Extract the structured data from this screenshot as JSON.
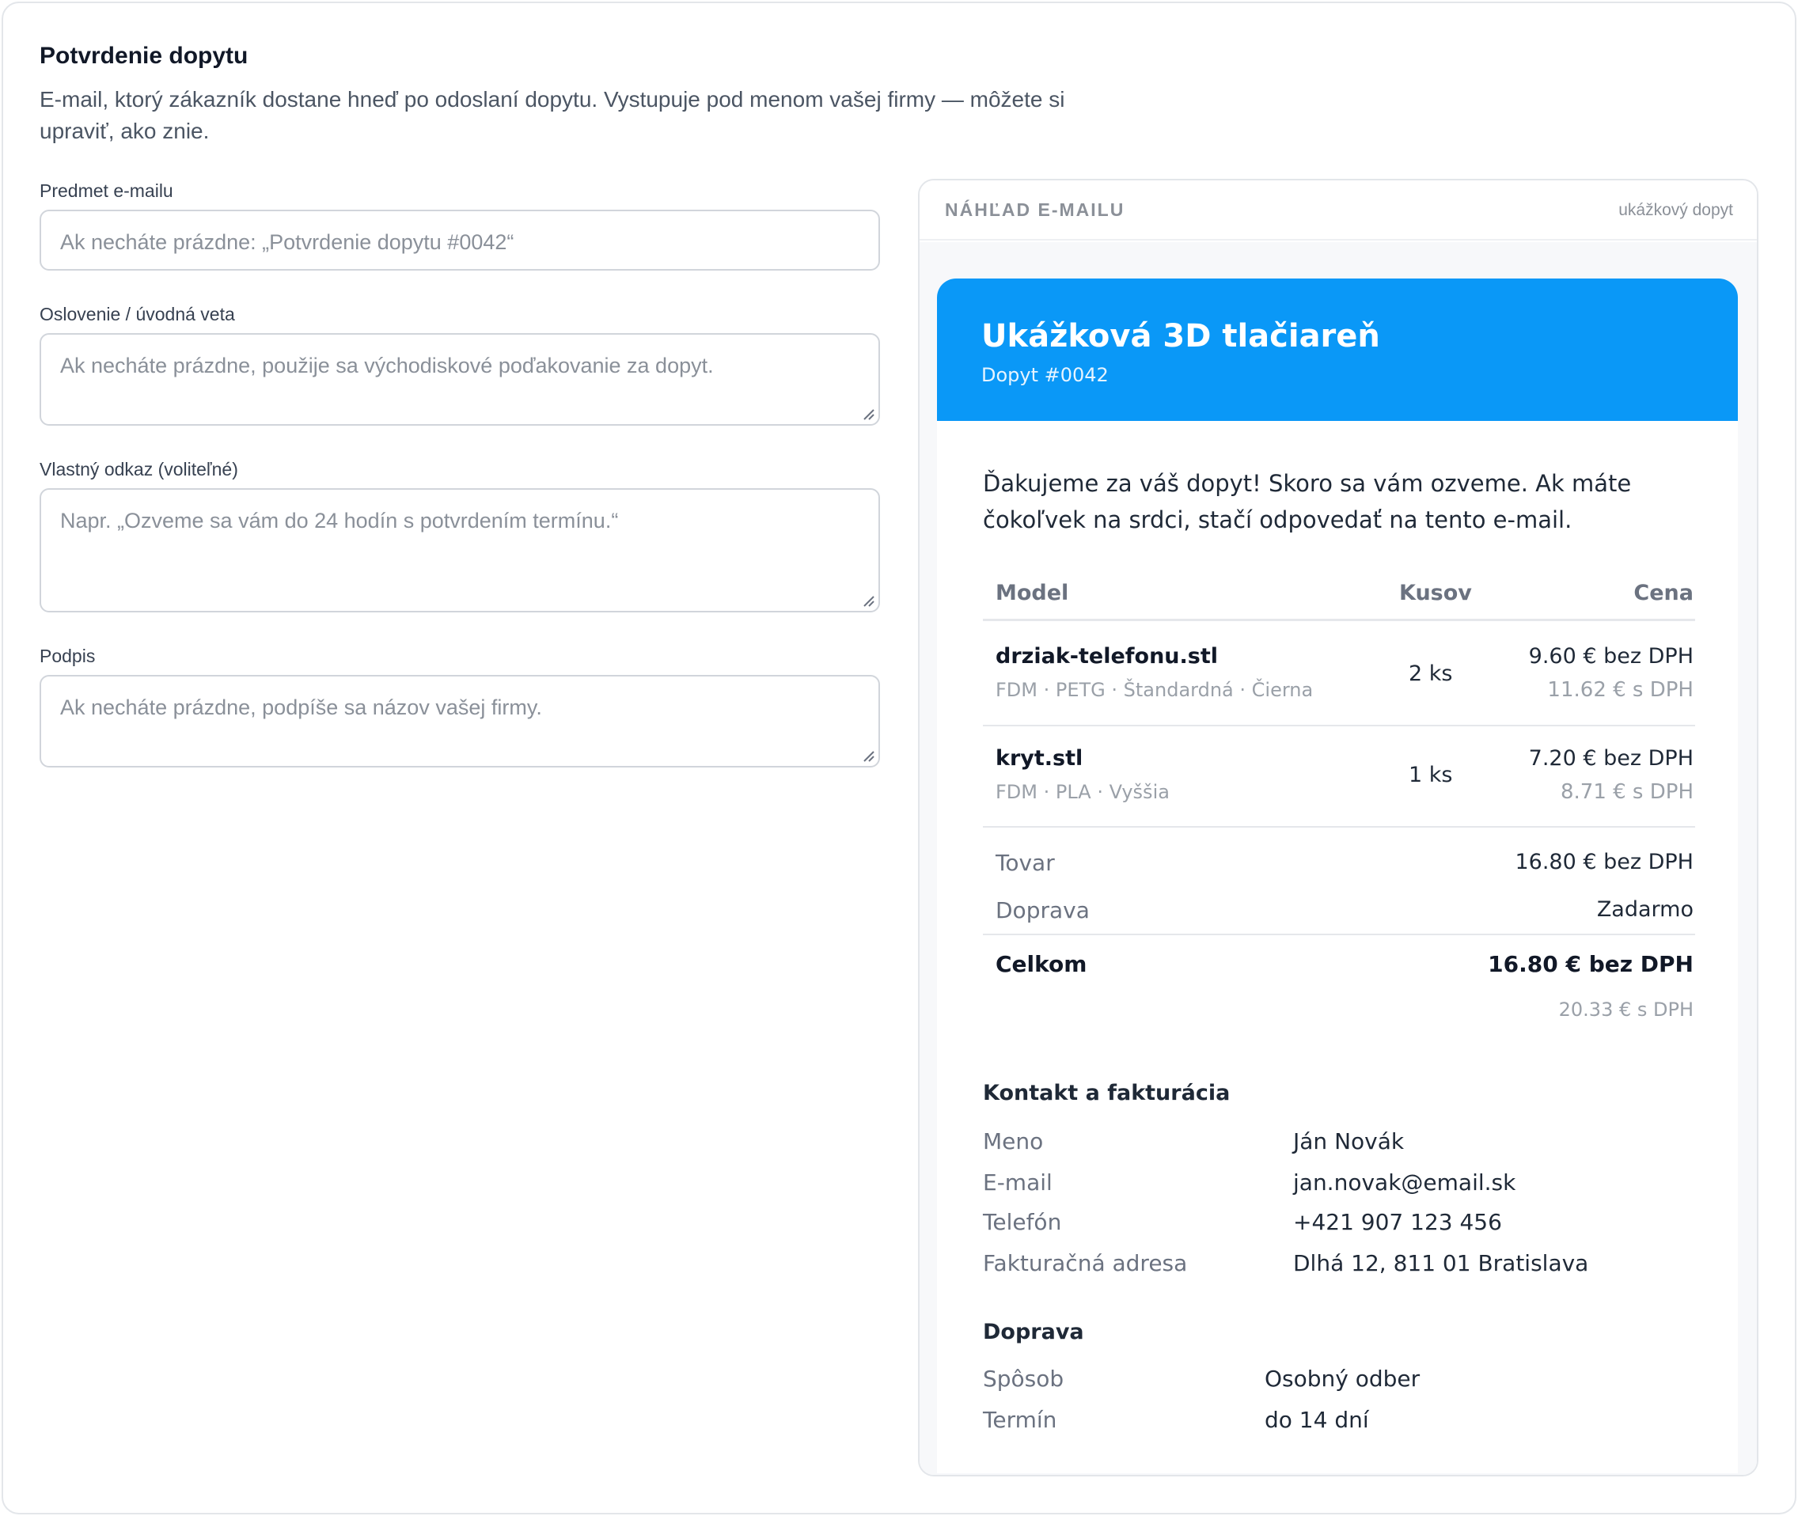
{
  "page": {
    "title": "Potvrdenie dopytu",
    "description": "E-mail, ktorý zákazník dostane hneď po odoslaní dopytu. Vystupuje pod menom vašej firmy — môžete si upraviť, ako znie."
  },
  "form": {
    "subject": {
      "label": "Predmet e-mailu",
      "placeholder": "Ak necháte prázdne: „Potvrdenie dopytu #0042“",
      "value": ""
    },
    "greeting": {
      "label": "Oslovenie / úvodná veta",
      "placeholder": "Ak necháte prázdne, použije sa východiskové poďakovanie za dopyt.",
      "value": ""
    },
    "custom_message": {
      "label": "Vlastný odkaz (voliteľné)",
      "placeholder": "Napr. „Ozveme sa vám do 24 hodín s potvrdením termínu.“",
      "value": ""
    },
    "signature": {
      "label": "Podpis",
      "placeholder": "Ak necháte prázdne, podpíše sa názov vašej firmy.",
      "value": ""
    }
  },
  "preview": {
    "header_title": "NÁHĽAD E-MAILU",
    "sample_label": "ukážkový dopyt",
    "email": {
      "shop_name": "Ukážková 3D tlačiareň",
      "inquiry_number": "Dopyt #0042",
      "intro": "Ďakujeme za váš dopyt! Skoro sa vám ozveme. Ak máte čokoľvek na srdci, stačí odpovedať na tento e-mail.",
      "table": {
        "headers": {
          "model": "Model",
          "qty": "Kusov",
          "price": "Cena"
        },
        "rows": [
          {
            "name": "drziak-telefonu.stl",
            "meta": "FDM · PETG · Štandardná · Čierna",
            "qty": "2 ks",
            "price_net": "9.60 € bez DPH",
            "price_gross": "11.62 € s DPH"
          },
          {
            "name": "kryt.stl",
            "meta": "FDM · PLA · Vyššia",
            "qty": "1 ks",
            "price_net": "7.20 € bez DPH",
            "price_gross": "8.71 € s DPH"
          }
        ]
      },
      "summary": {
        "goods_label": "Tovar",
        "goods_value": "16.80 € bez DPH",
        "shipping_label": "Doprava",
        "shipping_value": "Zadarmo",
        "total_label": "Celkom",
        "total_value": "16.80 € bez DPH",
        "total_gross": "20.33 € s DPH"
      },
      "contact": {
        "title": "Kontakt a fakturácia",
        "rows": [
          {
            "key": "Meno",
            "value": "Ján Novák"
          },
          {
            "key": "E-mail",
            "value": "jan.novak@email.sk"
          },
          {
            "key": "Telefón",
            "value": "+421 907 123 456"
          },
          {
            "key": "Fakturačná adresa",
            "value": "Dlhá 12, 811 01 Bratislava"
          }
        ]
      },
      "shipping": {
        "title": "Doprava",
        "rows": [
          {
            "key": "Spôsob",
            "value": "Osobný odber"
          },
          {
            "key": "Termín",
            "value": "do 14 dní"
          }
        ]
      }
    }
  },
  "colors": {
    "email_header": "#0a98f7",
    "border": "#d1d5db",
    "muted_text": "#8a9099"
  }
}
